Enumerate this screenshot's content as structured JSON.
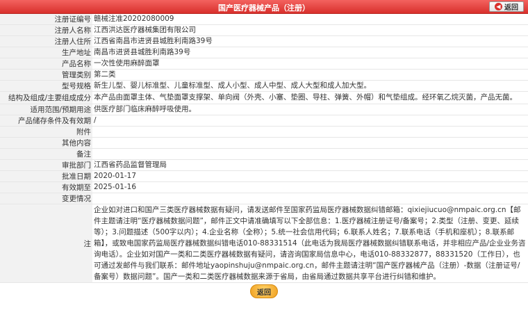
{
  "header": {
    "title": "国产医疗器械产品（注册）",
    "back_label": "返回"
  },
  "fields": [
    {
      "label": "注册证编号",
      "value": "赣械注准20202080009"
    },
    {
      "label": "注册人名称",
      "value": "江西洪达医疗器械集团有限公司"
    },
    {
      "label": "注册人住所",
      "value": "江西省南昌市进贤县城胜利南路39号"
    },
    {
      "label": "生产地址",
      "value": "南昌市进贤县城胜利南路39号"
    },
    {
      "label": "产品名称",
      "value": "一次性使用麻醉面罩"
    },
    {
      "label": "管理类别",
      "value": "第二类"
    },
    {
      "label": "型号规格",
      "value": "新生儿型、婴儿标准型、儿童标准型、成人小型、成人中型、成人大型和成人加大型。"
    },
    {
      "label": "结构及组成/主要组成成分",
      "value": "本产品由面罩主体、气垫面罩支撑架、单向阀（外壳、小塞、垫圈、导柱、弹簧、外帽）和气垫组成。经环氧乙烷灭菌，产品无菌。"
    },
    {
      "label": "适用范围/预期用途",
      "value": "供医疗部门临床麻醉呼吸使用。"
    },
    {
      "label": "产品储存条件及有效期",
      "value": "/"
    },
    {
      "label": "附件",
      "value": ""
    },
    {
      "label": "其他内容",
      "value": ""
    },
    {
      "label": "备注",
      "value": ""
    },
    {
      "label": "审批部门",
      "value": "江西省药品监督管理局"
    },
    {
      "label": "批准日期",
      "value": "2020-01-17"
    },
    {
      "label": "有效期至",
      "value": "2025-01-16"
    },
    {
      "label": "变更情况",
      "value": ""
    }
  ],
  "note": {
    "label": "注",
    "text": "企业如对进口和国产三类医疗器械数据有疑问，请发送邮件至国家药监局医疗器械数据纠错邮箱：qixiejiucuo@nmpaic.org.cn【邮件主题请注明“医疗器械数据问题”，邮件正文中请准确填写以下全部信息：1.医疗器械注册证号/备案号；2.类型（注册、变更、延续等）；3.问题描述（500字以内）；4.企业名称（全称）；5.统一社会信用代码；6.联系人姓名；7.联系电话（手机和座机）；8.联系邮箱】，或致电国家药监局医疗器械数据纠错电话010-88331514（此电话为我局医疗器械数据纠错联系电话，并非相应产品/企业业务咨询电话）。企业如对国产一类和二类医疗器械数据有疑问，请咨询国家局信息中心，电话010-88332877，88331520（工作日），也可通过发邮件与我们联系：邮件地址yaopinshuju@nmpaic.org.cn，邮件主题请注明“国产医疗器械产品（注册）-数据（注册证号/备案号）数据问题”。国产一类和二类医疗器械数据来源于省局，由省局通过数据共享平台进行纠错和维护。"
  },
  "footer": {
    "back_label": "返回"
  },
  "colors": {
    "header": "#d9302c",
    "label_bg": "#f2f2f2",
    "button": "#f0a020"
  }
}
